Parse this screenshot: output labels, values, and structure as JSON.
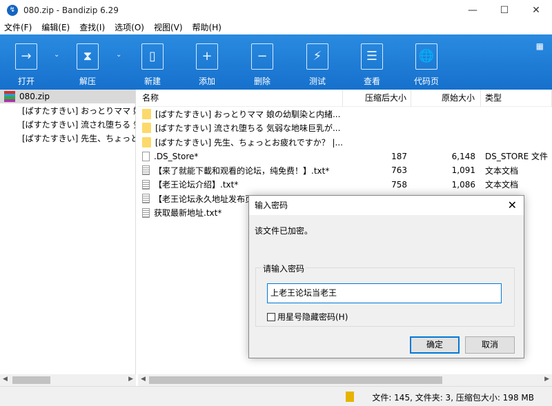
{
  "window": {
    "title": "080.zip - Bandizip 6.29",
    "min": "—",
    "max": "☐",
    "close": "✕"
  },
  "menu": [
    "文件(F)",
    "编辑(E)",
    "查找(I)",
    "选项(O)",
    "视图(V)",
    "帮助(H)"
  ],
  "toolbar": [
    {
      "label": "打开",
      "icon": "→"
    },
    {
      "label": "解压",
      "icon": "⧗"
    },
    {
      "label": "新建",
      "icon": "▯"
    },
    {
      "label": "添加",
      "icon": "+"
    },
    {
      "label": "删除",
      "icon": "−"
    },
    {
      "label": "测试",
      "icon": "⚡"
    },
    {
      "label": "查看",
      "icon": "☰"
    },
    {
      "label": "代码页",
      "icon": "🌐"
    }
  ],
  "tree": {
    "root": "080.zip",
    "children": [
      "[ぱすたすきい] おっとりママ 娘の幼馴染と内緒...",
      "[ぱすたすきい] 流され堕ちる 気弱な地味巨乳が...",
      "[ぱすたすきい] 先生、ちょっとお疲れですか？"
    ]
  },
  "columns": {
    "name": "名称",
    "packed": "压缩后大小",
    "original": "原始大小",
    "type": "类型"
  },
  "files": [
    {
      "name": "[ぱすたすきい] おっとりママ 娘の幼馴染と内緒...",
      "packed": "",
      "original": "",
      "type": "",
      "kind": "folder"
    },
    {
      "name": "[ぱすたすきい] 流され堕ちる 気弱な地味巨乳が...",
      "packed": "",
      "original": "",
      "type": "",
      "kind": "folder"
    },
    {
      "name": "[ぱすたすきい] 先生、ちょっとお疲れですか？ |...",
      "packed": "",
      "original": "",
      "type": "",
      "kind": "folder"
    },
    {
      "name": ".DS_Store*",
      "packed": "187",
      "original": "6,148",
      "type": "DS_STORE 文件",
      "kind": "file"
    },
    {
      "name": "【来了就能下載和观看的论坛，纯免费！】.txt*",
      "packed": "763",
      "original": "1,091",
      "type": "文本文档",
      "kind": "txt"
    },
    {
      "name": "【老王论坛介绍】.txt*",
      "packed": "758",
      "original": "1,086",
      "type": "文本文档",
      "kind": "txt"
    },
    {
      "name": "【老王论坛永久地址发布页",
      "packed": "",
      "original": "",
      "type": "",
      "kind": "txt"
    },
    {
      "name": "获取最新地址.txt*",
      "packed": "",
      "original": "",
      "type": "",
      "kind": "txt"
    }
  ],
  "status": "文件: 145, 文件夹: 3, 压缩包大小: 198 MB",
  "dialog": {
    "title": "输入密码",
    "message": "该文件已加密。",
    "group": "请输入密码",
    "password": "上老王论坛当老王",
    "mask_label": "用星号隐藏密码(H)",
    "ok": "确定",
    "cancel": "取消"
  }
}
